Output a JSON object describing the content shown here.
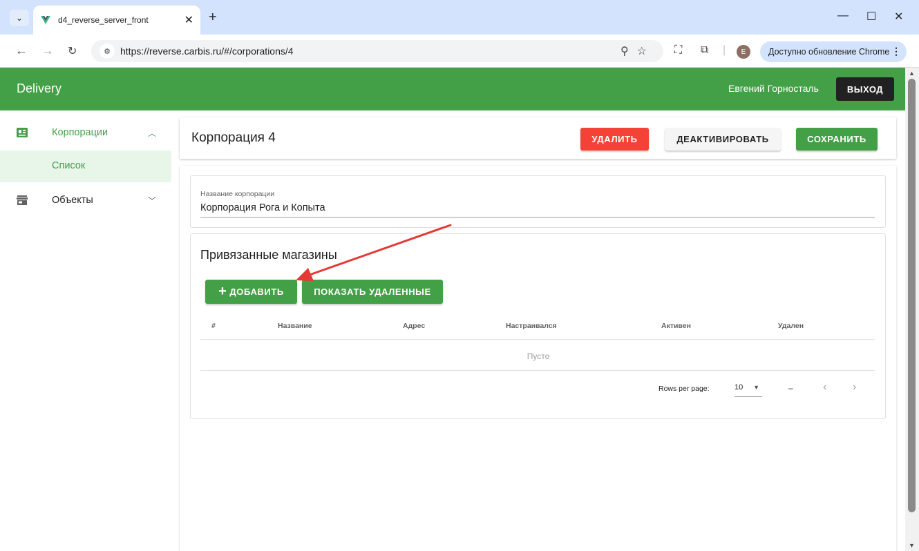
{
  "browser": {
    "tab_title": "d4_reverse_server_front",
    "tab_close": "✕",
    "new_tab": "+",
    "url": "https://reverse.carbis.ru/#/corporations/4",
    "profile_initial": "E",
    "update_label": "Доступно обновление Chrome",
    "window_controls": {
      "minimize": "—",
      "maximize": "☐",
      "close": "✕"
    }
  },
  "app": {
    "title": "Delivery",
    "user_name": "Евгений Горносталь",
    "logout_label": "ВЫХОД",
    "accent_color": "#43a047",
    "danger_color": "#f44336"
  },
  "sidebar": {
    "corporations_label": "Корпорации",
    "list_label": "Список",
    "objects_label": "Объекты"
  },
  "page": {
    "title": "Корпорация 4",
    "delete_label": "УДАЛИТЬ",
    "deactivate_label": "ДЕАКТИВИРОВАТЬ",
    "save_label": "СОХРАНИТЬ",
    "field_label": "Название корпорации",
    "field_value": "Корпорация Рога и Копыта"
  },
  "shops": {
    "title": "Привязанные магазины",
    "add_label": "ДОБАВИТЬ",
    "show_deleted_label": "ПОКАЗАТЬ УДАЛЕННЫЕ",
    "columns": [
      "#",
      "Название",
      "Адрес",
      "Настраивался",
      "Активен",
      "Удален"
    ],
    "empty_text": "Пусто",
    "rows_per_page_label": "Rows per page:",
    "rows_per_page_value": "10",
    "page_info": "–"
  }
}
